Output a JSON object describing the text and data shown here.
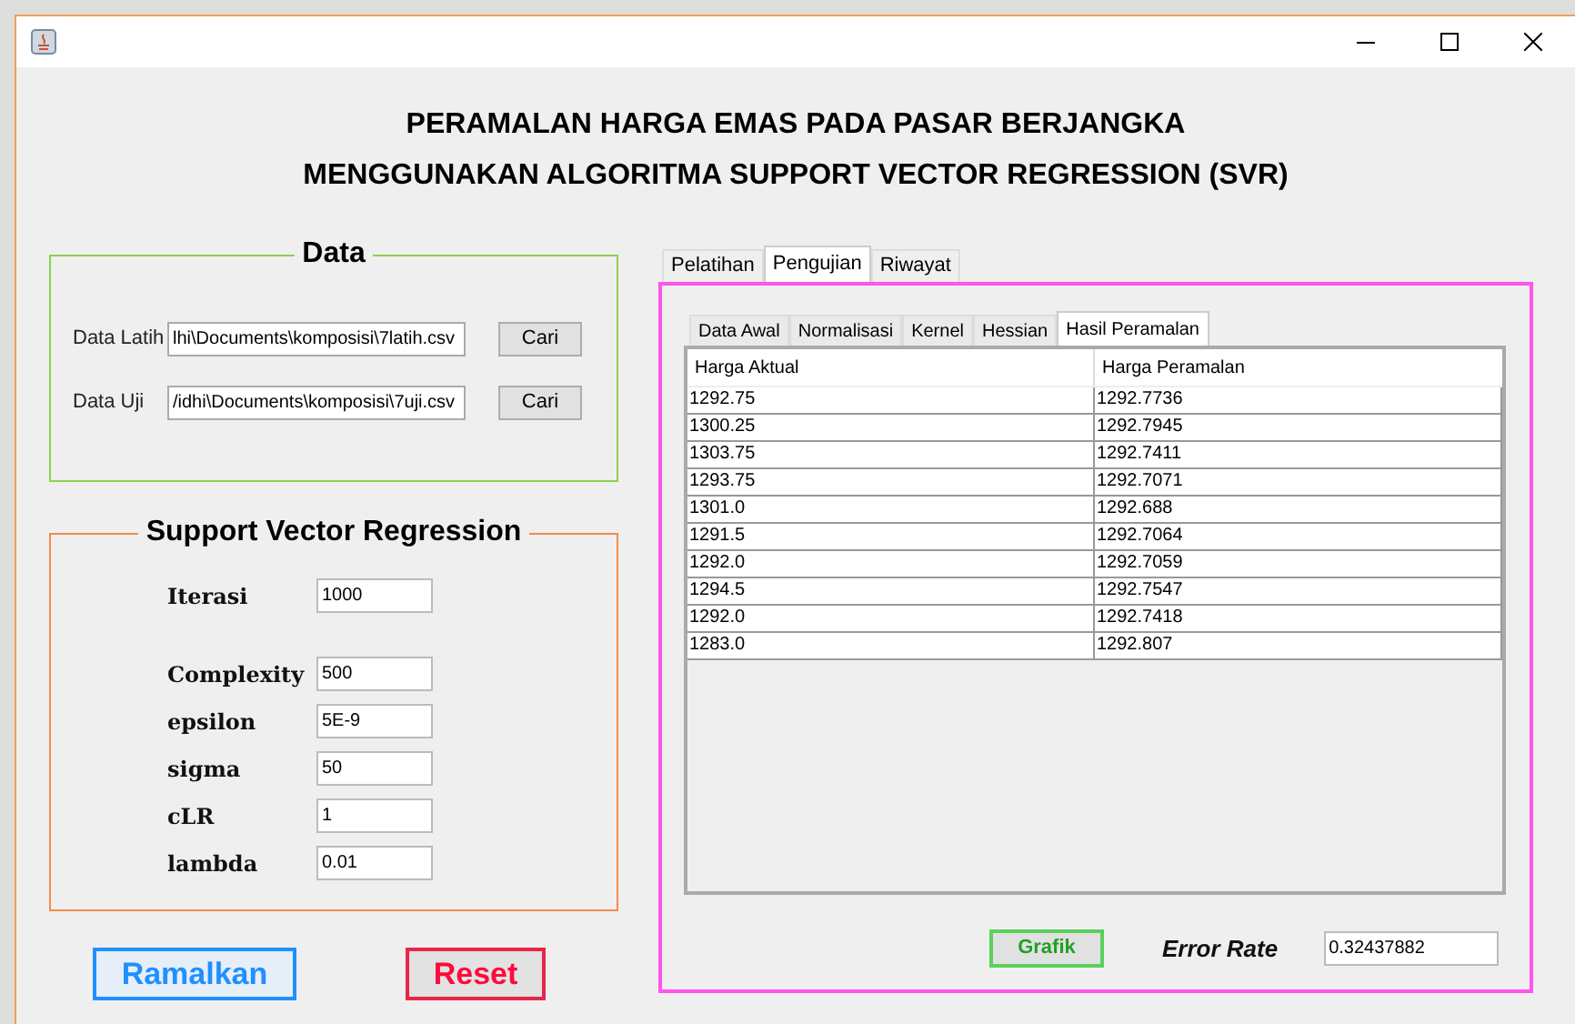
{
  "title": [
    "PERAMALAN HARGA EMAS PADA PASAR BERJANGKA",
    "MENGGUNAKAN ALGORITMA SUPPORT VECTOR REGRESSION (SVR)"
  ],
  "data_panel": {
    "title": "Data",
    "fields": [
      {
        "label": "Data Latih",
        "value": "lhi\\Documents\\komposisi\\7latih.csv",
        "button": "Cari"
      },
      {
        "label": "Data Uji",
        "value": "/idhi\\Documents\\komposisi\\7uji.csv",
        "button": "Cari"
      }
    ]
  },
  "svr_panel": {
    "title": "Support Vector Regression",
    "params": [
      {
        "label": "Iterasi",
        "value": "1000"
      },
      {
        "label": "Complexity",
        "value": "500"
      },
      {
        "label": "epsilon",
        "value": "5E-9"
      },
      {
        "label": "sigma",
        "value": "50"
      },
      {
        "label": "cLR",
        "value": "1"
      },
      {
        "label": "lambda",
        "value": "0.01"
      }
    ]
  },
  "buttons": [
    {
      "label": "Ramalkan",
      "kind": "primary"
    },
    {
      "label": "Reset",
      "kind": "danger"
    }
  ],
  "tabs": [
    {
      "label": "Pelatihan",
      "selected": false
    },
    {
      "label": "Pengujian",
      "selected": true
    },
    {
      "label": "Riwayat",
      "selected": false
    }
  ],
  "sub_tabs": [
    {
      "label": "Data Awal",
      "selected": false
    },
    {
      "label": "Normalisasi",
      "selected": false
    },
    {
      "label": "Kernel",
      "selected": false
    },
    {
      "label": "Hessian",
      "selected": false
    },
    {
      "label": "Hasil Peramalan",
      "selected": true
    }
  ],
  "table": {
    "columns": [
      "Harga Aktual",
      "Harga Peramalan"
    ],
    "rows": [
      [
        "1292.75",
        "1292.7736"
      ],
      [
        "1300.25",
        "1292.7945"
      ],
      [
        "1303.75",
        "1292.7411"
      ],
      [
        "1293.75",
        "1292.7071"
      ],
      [
        "1301.0",
        "1292.688"
      ],
      [
        "1291.5",
        "1292.7064"
      ],
      [
        "1292.0",
        "1292.7059"
      ],
      [
        "1294.5",
        "1292.7547"
      ],
      [
        "1292.0",
        "1292.7418"
      ],
      [
        "1283.0",
        "1292.807"
      ]
    ]
  },
  "grafik_button": "Grafik",
  "error_rate": {
    "label": "Error Rate",
    "value": "0.32437882"
  }
}
